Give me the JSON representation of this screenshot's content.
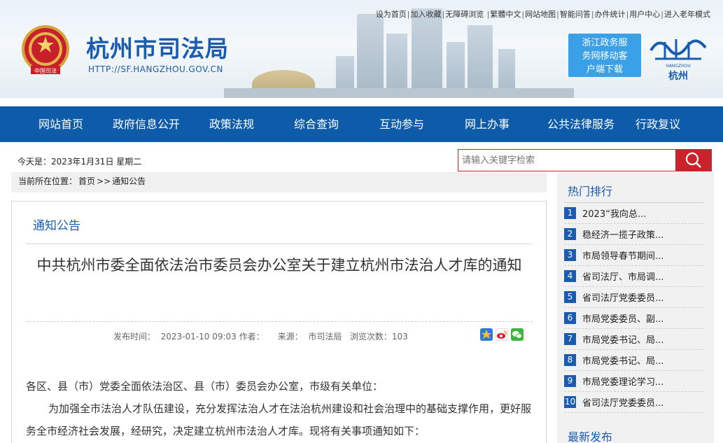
{
  "header": {
    "site_title": "杭州市司法局",
    "site_url": "HTTP://SF.HANGZHOU.GOV.CN",
    "emblem_caption": "中国司法",
    "app_download": [
      "浙江政务服",
      "务网移动客",
      "户端下载"
    ],
    "city_logo_text": "杭州",
    "city_logo_small": "HANGZHOU",
    "top_links": [
      "设为首页",
      "加入收藏",
      "无障碍浏览",
      "繁體中文",
      "网站地图",
      "智能问答",
      "办件统计",
      "用户中心",
      "进入老年模式"
    ]
  },
  "nav": {
    "items": [
      "网站首页",
      "政府信息公开",
      "政策法规",
      "综合查询",
      "互动参与",
      "网上办事",
      "公共法律服务",
      "行政复议"
    ]
  },
  "date_line": "今天是：2023年1月31日 星期二",
  "search": {
    "placeholder": "请输入关键字检索"
  },
  "breadcrumb": {
    "label": "当前所在位置：",
    "home": "首页",
    "sep": ">>",
    "current": "通知公告"
  },
  "article": {
    "column": "通知公告",
    "title": "中共杭州市委全面依法治市委员会办公室关于建立杭州市法治人才库的通知",
    "meta": {
      "publish_label": "发布时间：",
      "publish_time": "2023-01-10 09:03",
      "author_label": "作者：",
      "source_label": "来源：",
      "source": "市司法局",
      "views_label": "浏览次数：",
      "views": "103"
    },
    "paragraphs": [
      "各区、县（市）党委全面依法治区、县（市）委员会办公室，市级有关单位：",
      "为加强全市法治人才队伍建设，充分发挥法治人才在法治杭州建设和社会治理中的基础支撑作用，更好服务全市经济社会发展，经研究，决定建立杭州市法治人才库。现将有关事项通知如下："
    ]
  },
  "sidebar": {
    "hot_title": "热门排行",
    "items": [
      {
        "num": "1",
        "text": "2023“我向总..."
      },
      {
        "num": "2",
        "text": "稳经济一揽子政策..."
      },
      {
        "num": "3",
        "text": "市局领导春节期间..."
      },
      {
        "num": "4",
        "text": "省司法厅、市局调..."
      },
      {
        "num": "5",
        "text": "省司法厅党委委员..."
      },
      {
        "num": "6",
        "text": "市局党委委员、副..."
      },
      {
        "num": "7",
        "text": "市局党委书记、局..."
      },
      {
        "num": "8",
        "text": "市局党委书记、局..."
      },
      {
        "num": "9",
        "text": "市局党委理论学习..."
      },
      {
        "num": "10",
        "text": "省司法厅党委委员..."
      }
    ],
    "latest_title": "最新发布"
  },
  "colors": {
    "brand_blue": "#1a5cb0",
    "nav_blue": "#0d5ba9",
    "accent_red": "#c9242b"
  }
}
